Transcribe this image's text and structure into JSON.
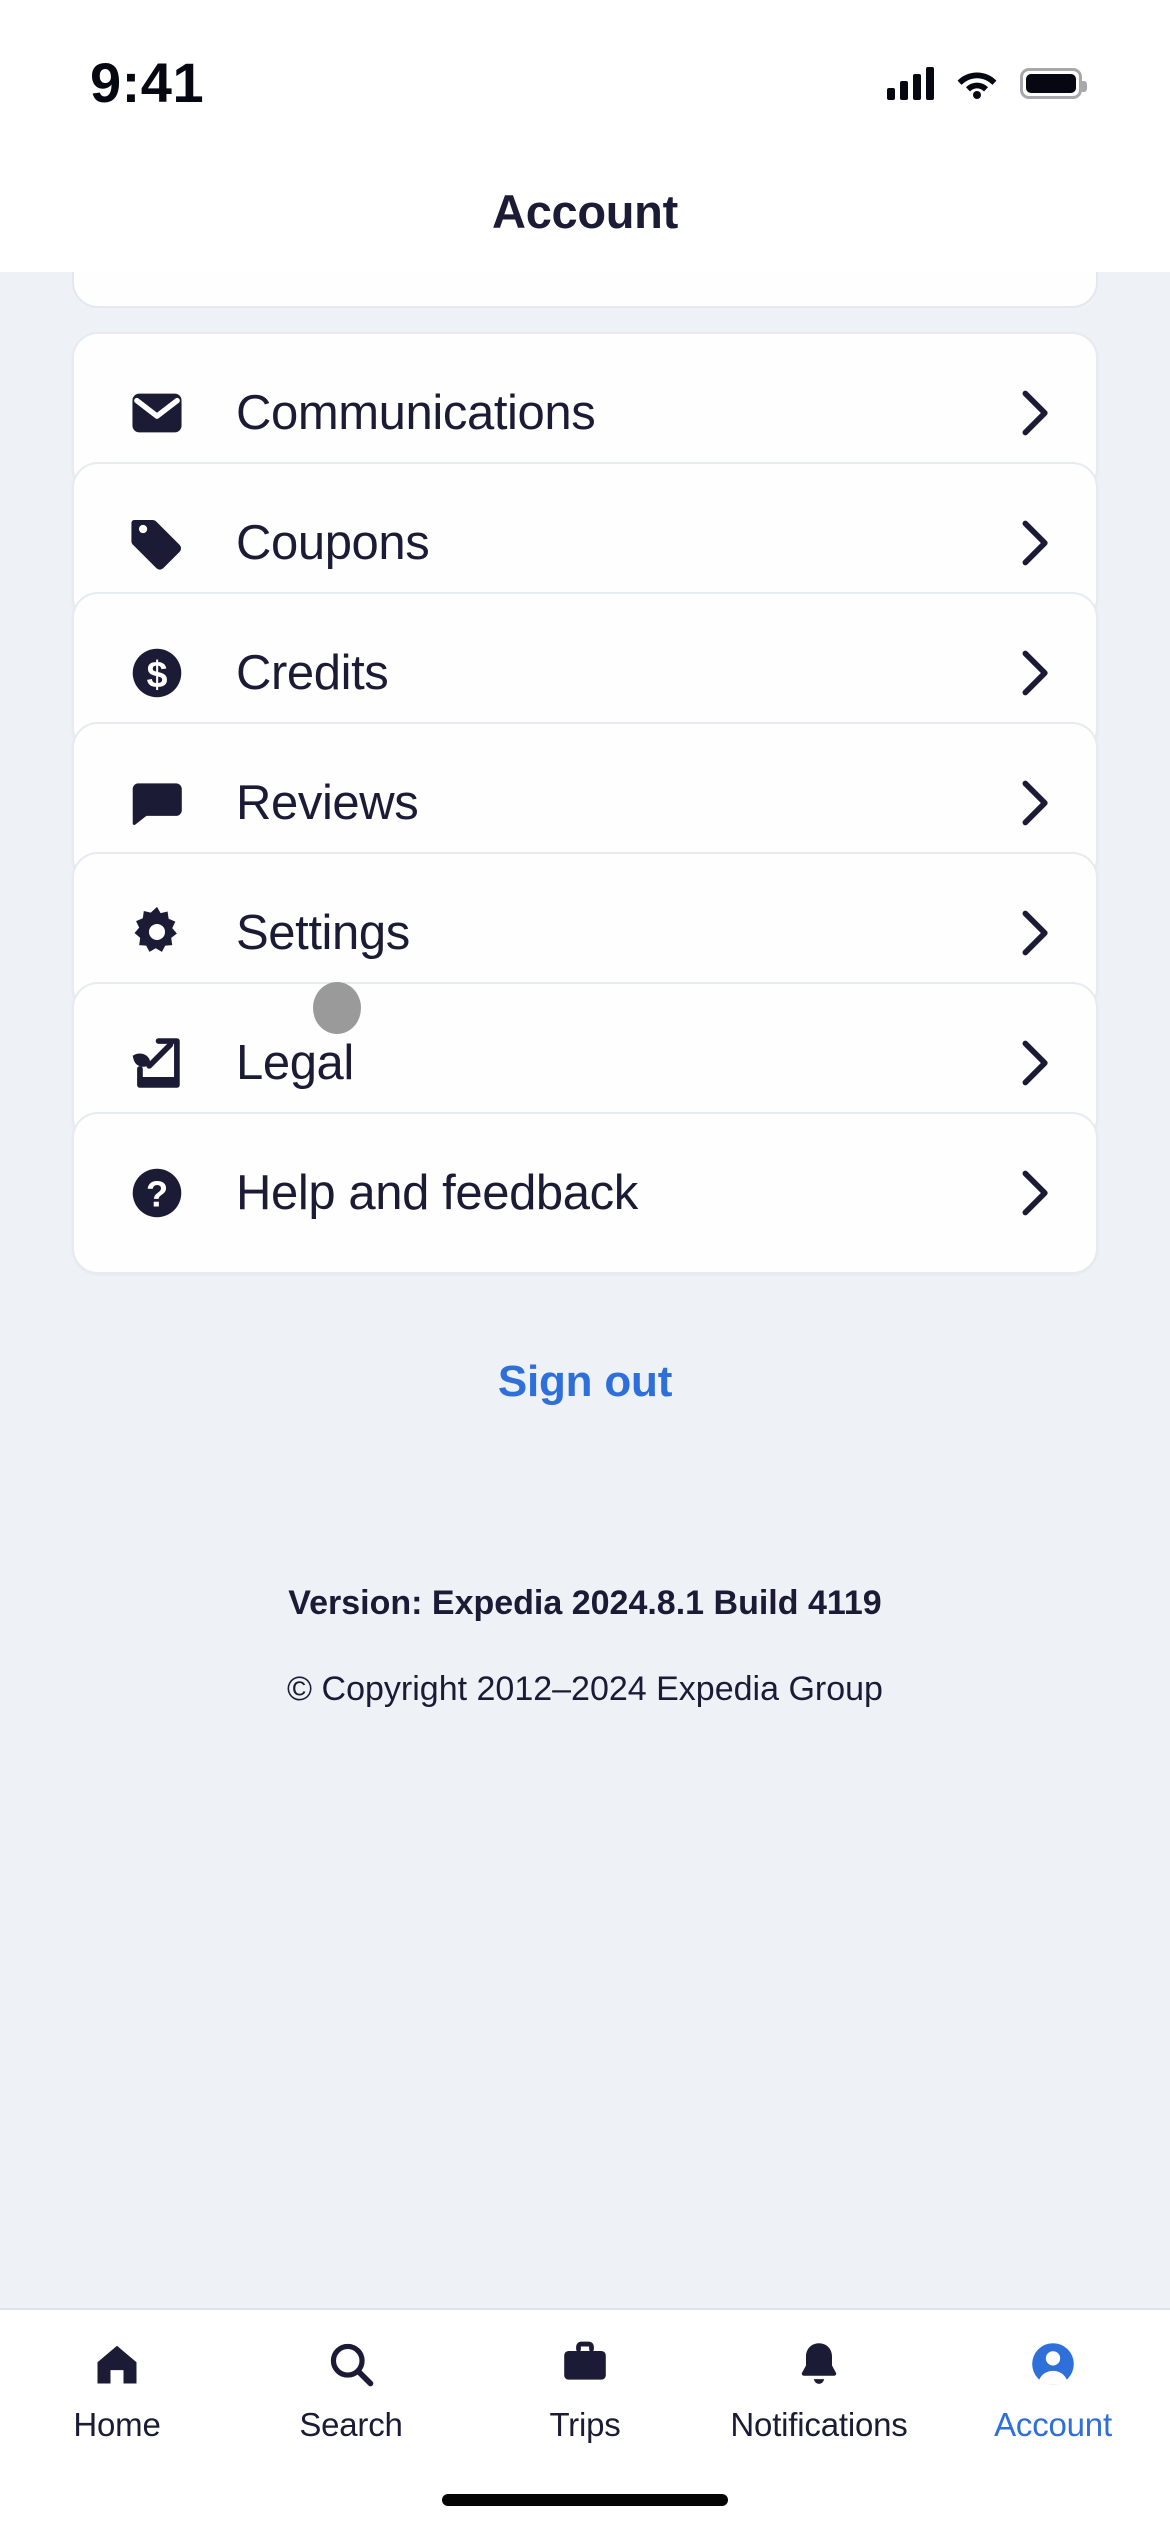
{
  "status_bar": {
    "time": "9:41",
    "cellular_icon": "signal-bars-icon",
    "wifi_icon": "wifi-icon",
    "battery_icon": "battery-full-icon"
  },
  "header": {
    "title": "Account"
  },
  "theme": {
    "background": "#eef1f6",
    "card": "#fefefe",
    "ink": "#1c1b36",
    "accent": "#2f6fd9",
    "border": "#e6eaf1",
    "touch_indicator": "#9a9a9a"
  },
  "menu": {
    "items": [
      {
        "label": "Communications",
        "icon": "envelope-icon",
        "chevron": "chevron-right-icon"
      },
      {
        "label": "Coupons",
        "icon": "tag-icon",
        "chevron": "chevron-right-icon"
      },
      {
        "label": "Credits",
        "icon": "dollar-circle-icon",
        "chevron": "chevron-right-icon"
      },
      {
        "label": "Reviews",
        "icon": "speech-bubble-icon",
        "chevron": "chevron-right-icon"
      },
      {
        "label": "Settings",
        "icon": "gear-icon",
        "chevron": "chevron-right-icon"
      },
      {
        "label": "Legal",
        "icon": "quill-document-icon",
        "chevron": "chevron-right-icon"
      },
      {
        "label": "Help and feedback",
        "icon": "question-circle-icon",
        "chevron": "chevron-right-icon"
      }
    ]
  },
  "footer": {
    "sign_out_label": "Sign out",
    "version": "Version: Expedia 2024.8.1 Build 4119",
    "copyright": "© Copyright 2012–2024 Expedia Group"
  },
  "tab_bar": {
    "items": [
      {
        "label": "Home",
        "icon": "home-icon",
        "active": false
      },
      {
        "label": "Search",
        "icon": "magnifier-icon",
        "active": false
      },
      {
        "label": "Trips",
        "icon": "briefcase-icon",
        "active": false
      },
      {
        "label": "Notifications",
        "icon": "bell-icon",
        "active": false
      },
      {
        "label": "Account",
        "icon": "person-circle-icon",
        "active": true
      }
    ]
  }
}
